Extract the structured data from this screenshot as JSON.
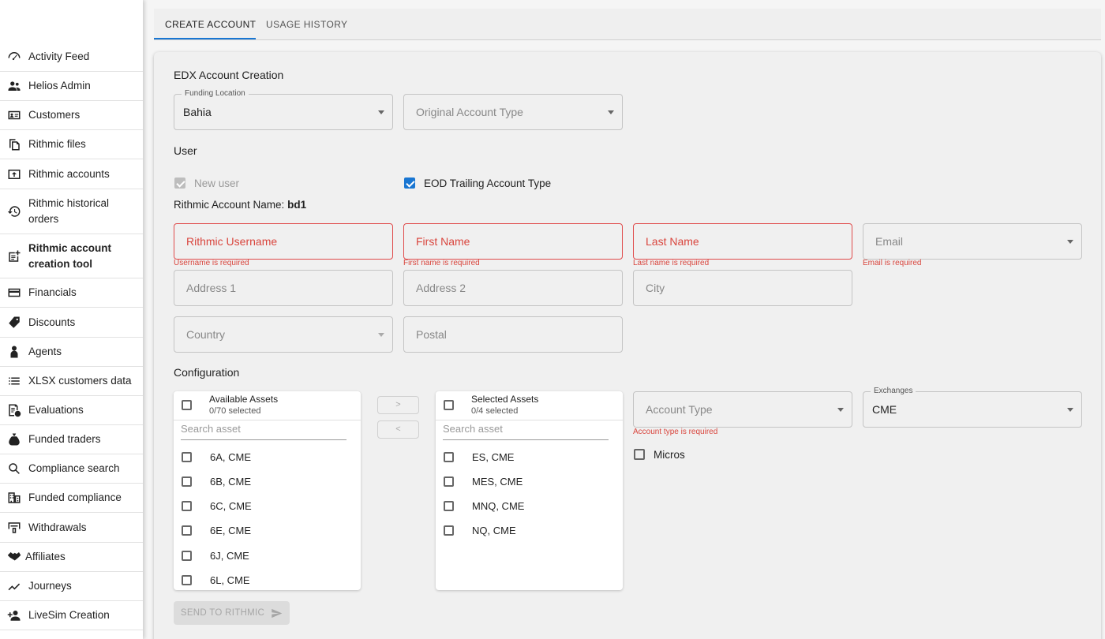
{
  "sidebar": {
    "items": [
      {
        "label": "Activity Feed",
        "icon": "speedometer-icon"
      },
      {
        "label": "Helios Admin",
        "icon": "people-icon"
      },
      {
        "label": "Customers",
        "icon": "id-card-icon"
      },
      {
        "label": "Rithmic files",
        "icon": "file-copy-icon"
      },
      {
        "label": "Rithmic accounts",
        "icon": "upload-box-icon"
      },
      {
        "label": "Rithmic historical orders",
        "icon": "history-icon"
      },
      {
        "label": "Rithmic account creation tool",
        "icon": "note-add-icon"
      },
      {
        "label": "Financials",
        "icon": "credit-card-icon"
      },
      {
        "label": "Discounts",
        "icon": "tag-icon"
      },
      {
        "label": "Agents",
        "icon": "person-icon"
      },
      {
        "label": "XLSX customers data",
        "icon": "list-icon"
      },
      {
        "label": "Evaluations",
        "icon": "evaluation-icon"
      },
      {
        "label": "Funded traders",
        "icon": "money-bag-icon"
      },
      {
        "label": "Compliance search",
        "icon": "search-icon"
      },
      {
        "label": "Funded compliance",
        "icon": "building-icon"
      },
      {
        "label": "Withdrawals",
        "icon": "withdrawal-icon"
      },
      {
        "label": "Affiliates",
        "icon": "handshake-icon"
      },
      {
        "label": "Journeys",
        "icon": "trend-line-icon"
      },
      {
        "label": "LiveSim Creation",
        "icon": "person-add-icon"
      }
    ]
  },
  "tabs": [
    {
      "label": "CREATE ACCOUNT",
      "active": true
    },
    {
      "label": "USAGE HISTORY",
      "active": false
    }
  ],
  "form": {
    "title": "EDX Account Creation",
    "funding_location": {
      "label": "Funding Location",
      "value": "Bahia"
    },
    "original_account_type": {
      "placeholder": "Original Account Type"
    },
    "user_section": "User",
    "new_user_label": "New user",
    "eod_trailing_label": "EOD Trailing Account Type",
    "account_name_label": "Rithmic Account Name:",
    "account_name_value": "bd1",
    "rithmic_username": {
      "placeholder": "Rithmic Username",
      "error": "Username is required"
    },
    "first_name": {
      "placeholder": "First Name",
      "error": "First name is required"
    },
    "last_name": {
      "placeholder": "Last Name",
      "error": "Last name is required"
    },
    "email": {
      "placeholder": "Email",
      "error": "Email is required"
    },
    "address1": {
      "placeholder": "Address 1"
    },
    "address2": {
      "placeholder": "Address 2"
    },
    "city": {
      "placeholder": "City"
    },
    "country": {
      "placeholder": "Country"
    },
    "postal": {
      "placeholder": "Postal"
    },
    "configuration_section": "Configuration",
    "available": {
      "title": "Available Assets",
      "count": "0/70 selected",
      "search_placeholder": "Search asset",
      "items": [
        "6A, CME",
        "6B, CME",
        "6C, CME",
        "6E, CME",
        "6J, CME",
        "6L, CME"
      ]
    },
    "selected": {
      "title": "Selected Assets",
      "count": "0/4 selected",
      "search_placeholder": "Search asset",
      "items": [
        "ES, CME",
        "MES, CME",
        "MNQ, CME",
        "NQ, CME"
      ]
    },
    "move_right_label": ">",
    "move_left_label": "<",
    "account_type": {
      "placeholder": "Account Type",
      "error": "Account type is required"
    },
    "exchanges": {
      "label": "Exchanges",
      "value": "CME"
    },
    "micros_label": "Micros",
    "send_button": "SEND TO RITHMIC"
  },
  "colors": {
    "accent": "#1976d2",
    "error": "#d9453d"
  }
}
